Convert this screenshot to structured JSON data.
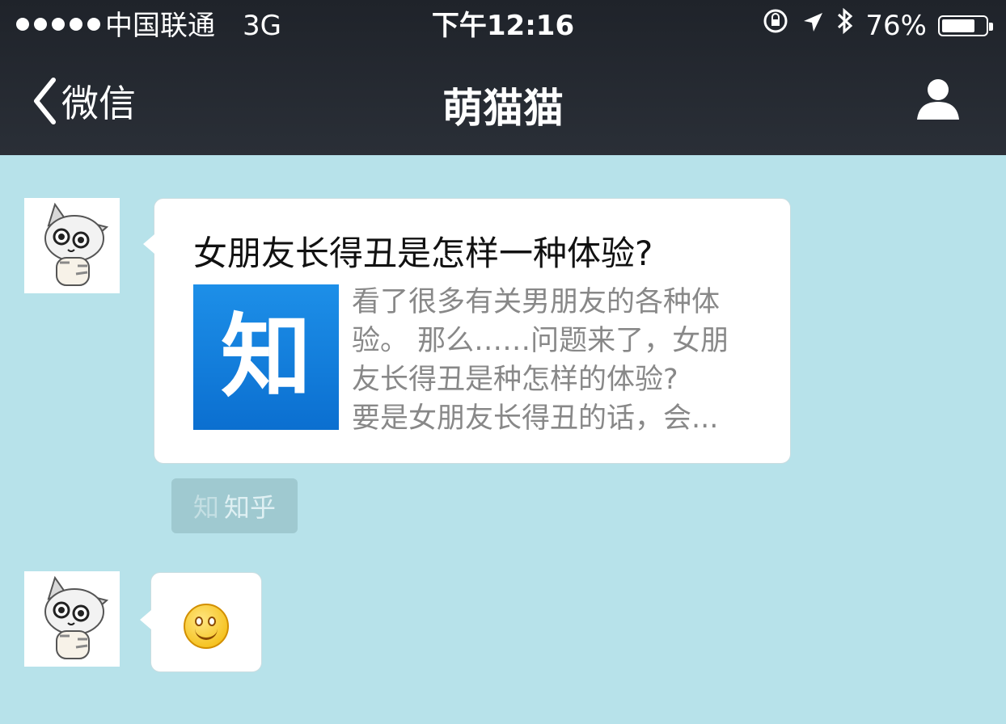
{
  "status_bar": {
    "carrier": "中国联通",
    "network": "3G",
    "time": "下午12:16",
    "battery": "76%",
    "battery_level": 0.76
  },
  "nav": {
    "back_label": "微信",
    "title": "萌猫猫"
  },
  "messages": [
    {
      "type": "article",
      "title": "女朋友长得丑是怎样一种体验?",
      "thumb_text": "知",
      "description_lines": [
        "看了很多有关男朋友的各种体",
        "验。 那么……问题来了，女朋",
        "友长得丑是种怎样的体验?",
        "要是女朋友长得丑的话，会..."
      ],
      "source_icon": "知",
      "source_label": "知乎"
    },
    {
      "type": "emoji",
      "icon": "smiley-icon"
    }
  ],
  "colors": {
    "header_bg": "#23272e",
    "chat_bg": "#b7e2ea",
    "zhihu_blue": "#0f78dc"
  }
}
